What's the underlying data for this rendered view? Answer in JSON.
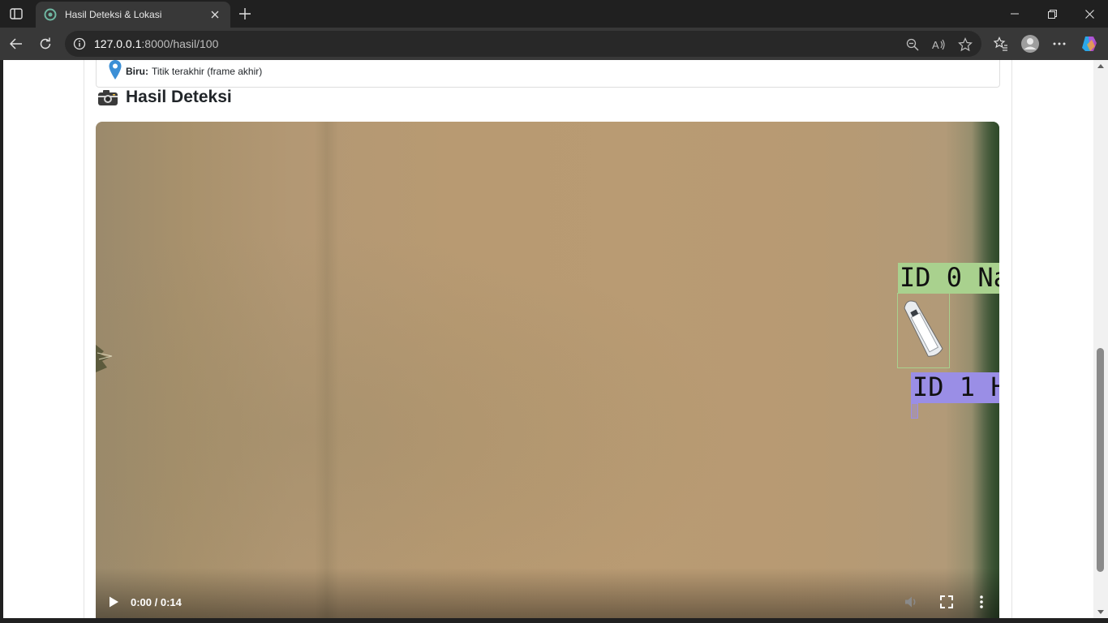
{
  "browser": {
    "tab_title": "Hasil Deteksi & Lokasi",
    "url_host": "127.0.0.1",
    "url_path": ":8000/hasil/100",
    "icons": [
      "sidebar-toggle-icon",
      "tab-favicon-icon",
      "close-icon",
      "plus-icon",
      "minimize-icon",
      "restore-icon",
      "close-window-icon",
      "back-icon",
      "refresh-icon",
      "info-icon",
      "zoom-out-icon",
      "read-aloud-icon",
      "favorite-star-icon",
      "favorites-icon",
      "profile-icon",
      "more-icon",
      "copilot-icon"
    ]
  },
  "legend": {
    "pin_color": "#3b8fd6",
    "label": "Biru:",
    "text": "Titik terakhir (frame akhir)"
  },
  "section": {
    "icon": "camera-icon",
    "title": "Hasil Deteksi"
  },
  "video": {
    "detections": [
      {
        "label": "ID 0 Na",
        "color": "#a9d18e"
      },
      {
        "label": "ID 1 H",
        "color": "#9a8ee6"
      }
    ],
    "controls": {
      "time": "0:00 / 0:14",
      "progress": 0.0,
      "icons": [
        "play-icon",
        "volume-icon",
        "fullscreen-icon",
        "more-options-icon"
      ]
    }
  }
}
